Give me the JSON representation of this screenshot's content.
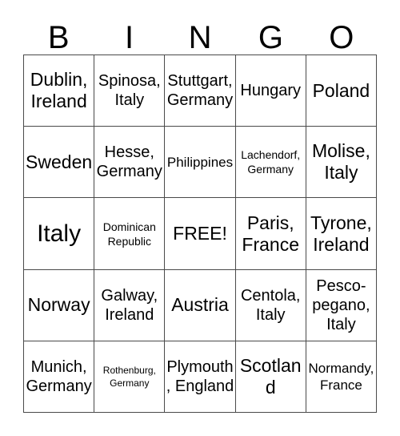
{
  "header": {
    "letters": [
      "B",
      "I",
      "N",
      "G",
      "O"
    ]
  },
  "grid": {
    "columns": 5,
    "rows": 5,
    "free_space_label": "FREE!",
    "cells": [
      [
        {
          "text": "Dublin, Ireland",
          "size": "lg"
        },
        {
          "text": "Spinosa, Italy",
          "size": "md"
        },
        {
          "text": "Stuttgart, Germany",
          "size": "md"
        },
        {
          "text": "Hungary",
          "size": "md"
        },
        {
          "text": "Poland",
          "size": "lg"
        }
      ],
      [
        {
          "text": "Sweden",
          "size": "lg"
        },
        {
          "text": "Hesse, Germany",
          "size": "md"
        },
        {
          "text": "Philippines",
          "size": "sm"
        },
        {
          "text": "Lachendorf, Germany",
          "size": "xs"
        },
        {
          "text": "Molise, Italy",
          "size": "lg"
        }
      ],
      [
        {
          "text": "Italy",
          "size": "xl"
        },
        {
          "text": "Dominican Republic",
          "size": "xs"
        },
        {
          "text": "FREE!",
          "size": "lg"
        },
        {
          "text": "Paris, France",
          "size": "lg"
        },
        {
          "text": "Tyrone, Ireland",
          "size": "lg"
        }
      ],
      [
        {
          "text": "Norway",
          "size": "lg"
        },
        {
          "text": "Galway, Ireland",
          "size": "md"
        },
        {
          "text": "Austria",
          "size": "lg"
        },
        {
          "text": "Centola, Italy",
          "size": "md"
        },
        {
          "text": "Pesco-pegano, Italy",
          "size": "md"
        }
      ],
      [
        {
          "text": "Munich, Germany",
          "size": "md"
        },
        {
          "text": "Rothenburg, Germany",
          "size": "xxs"
        },
        {
          "text": "Plymouth, England",
          "size": "md"
        },
        {
          "text": "Scotland",
          "size": "lg"
        },
        {
          "text": "Normandy, France",
          "size": "sm"
        }
      ]
    ]
  },
  "colors": {
    "background": "#ffffff",
    "text": "#000000",
    "grid_line": "#4a4a4a"
  }
}
